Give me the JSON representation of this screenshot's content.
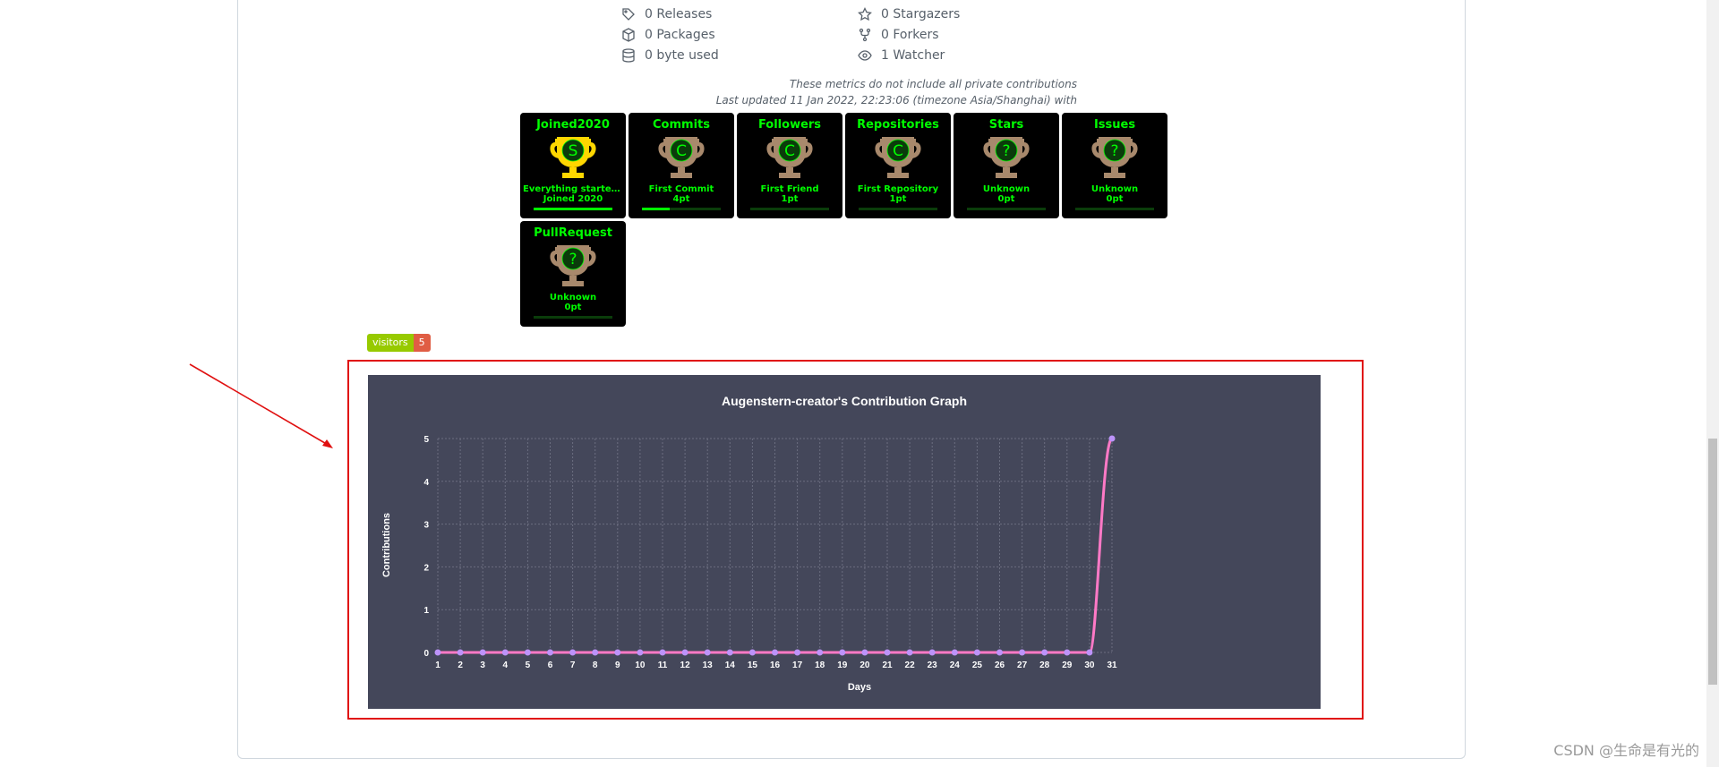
{
  "metrics": {
    "left": [
      {
        "icon": "tag-icon",
        "text": "0 Releases"
      },
      {
        "icon": "package-icon",
        "text": "0 Packages"
      },
      {
        "icon": "database-icon",
        "text": "0 byte used"
      }
    ],
    "right": [
      {
        "icon": "star-icon",
        "text": "0 Stargazers"
      },
      {
        "icon": "fork-icon",
        "text": "0 Forkers"
      },
      {
        "icon": "eye-icon",
        "text": "1 Watcher"
      }
    ]
  },
  "notes": {
    "line1": "These metrics do not include all private contributions",
    "line2": "Last updated 11 Jan 2022, 22:23:06 (timezone Asia/Shanghai) with"
  },
  "trophies": [
    {
      "title": "Joined2020",
      "letter": "S",
      "rank_color": "#ffd700",
      "subtitle": "Everything started...",
      "points": "Joined 2020",
      "progress": 1.0
    },
    {
      "title": "Commits",
      "letter": "C",
      "rank_color": "#a8896c",
      "subtitle": "First Commit",
      "points": "4pt",
      "progress": 0.35
    },
    {
      "title": "Followers",
      "letter": "C",
      "rank_color": "#a8896c",
      "subtitle": "First Friend",
      "points": "1pt",
      "progress": 0.0
    },
    {
      "title": "Repositories",
      "letter": "C",
      "rank_color": "#a8896c",
      "subtitle": "First Repository",
      "points": "1pt",
      "progress": 0.0
    },
    {
      "title": "Stars",
      "letter": "?",
      "rank_color": "#a8896c",
      "subtitle": "Unknown",
      "points": "0pt",
      "progress": 0.0
    },
    {
      "title": "Issues",
      "letter": "?",
      "rank_color": "#a8896c",
      "subtitle": "Unknown",
      "points": "0pt",
      "progress": 0.0
    },
    {
      "title": "PullRequest",
      "letter": "?",
      "rank_color": "#a8896c",
      "subtitle": "Unknown",
      "points": "0pt",
      "progress": 0.0
    }
  ],
  "badge": {
    "label": "visitors",
    "count": "5"
  },
  "chart_data": {
    "type": "line",
    "title": "Augenstern-creator's Contribution Graph",
    "xlabel": "Days",
    "ylabel": "Contributions",
    "x": [
      1,
      2,
      3,
      4,
      5,
      6,
      7,
      8,
      9,
      10,
      11,
      12,
      13,
      14,
      15,
      16,
      17,
      18,
      19,
      20,
      21,
      22,
      23,
      24,
      25,
      26,
      27,
      28,
      29,
      30,
      31
    ],
    "series": [
      {
        "values": [
          0,
          0,
          0,
          0,
          0,
          0,
          0,
          0,
          0,
          0,
          0,
          0,
          0,
          0,
          0,
          0,
          0,
          0,
          0,
          0,
          0,
          0,
          0,
          0,
          0,
          0,
          0,
          0,
          0,
          0,
          5
        ]
      }
    ],
    "ylim": [
      0,
      5
    ],
    "yticks": [
      0,
      1,
      2,
      3,
      4,
      5
    ],
    "grid": true,
    "colors": {
      "background": "#44475a",
      "line": "#ff79c6",
      "point": "#bd93f9",
      "grid": "#6b6e80",
      "text": "#ffffff"
    }
  },
  "watermark": "CSDN @生命是有光的"
}
